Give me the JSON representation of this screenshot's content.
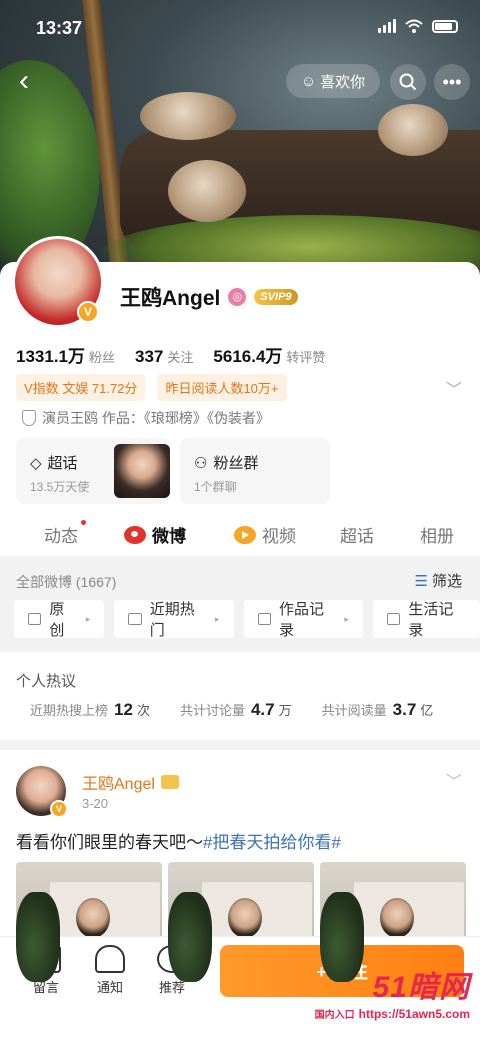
{
  "status_bar": {
    "time": "13:37"
  },
  "header": {
    "like_label": "喜欢你"
  },
  "profile": {
    "name": "王鸥Angel",
    "svip": "SVIP9",
    "stats": [
      {
        "value": "1331.1万",
        "label": "粉丝"
      },
      {
        "value": "337",
        "label": "关注"
      },
      {
        "value": "5616.4万",
        "label": "转评赞"
      }
    ],
    "tags": [
      "V指数 文娱 71.72分",
      "昨日阅读人数10万+"
    ],
    "intro": "演员王鸥 作品：《琅琊榜》《伪装者》",
    "cards": [
      {
        "title": "超话",
        "sub": "13.5万天使"
      },
      {
        "title": "粉丝群",
        "sub": "1个群聊"
      }
    ]
  },
  "tabs": [
    "动态",
    "微博",
    "视频",
    "超话",
    "相册"
  ],
  "feed": {
    "count_label": "全部微博 (1667)",
    "filter_label": "筛选",
    "chips": [
      "原创",
      "近期热门",
      "作品记录",
      "生活记录"
    ]
  },
  "hot": {
    "title": "个人热议",
    "items": [
      {
        "label": "近期热搜上榜",
        "value": "12",
        "unit": "次"
      },
      {
        "label": "共计讨论量",
        "value": "4.7",
        "unit": "万"
      },
      {
        "label": "共计阅读量",
        "value": "3.7",
        "unit": "亿"
      }
    ]
  },
  "post": {
    "author": "王鸥Angel",
    "date": "3-20",
    "text": "看看你们眼里的春天吧～",
    "topic": "#把春天拍给你看#"
  },
  "bottom_bar": {
    "items": [
      "留言",
      "通知",
      "推荐"
    ],
    "follow_label": "+ 关注"
  },
  "watermark": {
    "logo": "51暗网",
    "prefix": "国内入口",
    "url": "https://51awn5.com"
  },
  "colors": {
    "accent_orange": "#ff8a1f",
    "weibo_red": "#e0352b",
    "link_blue": "#3b73b9"
  }
}
